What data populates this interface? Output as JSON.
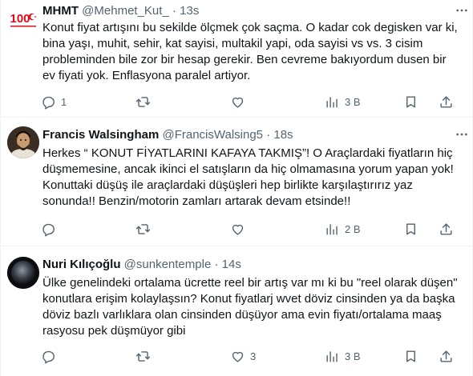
{
  "tweets": [
    {
      "name": "MHMT",
      "handle": "@Mehmet_Kut_",
      "dot": "·",
      "time": "13s",
      "avatar_badge": "100",
      "text": "Konut fiyat artışını bu sekilde ölçmek çok saçma. O kadar cok degisken var ki, bina yaşı, muhit, sehir, kat sayisi, multakil yapi, oda sayisi vs vs. 3 cisim probleminden bile zor bir hesap gerekir. Ben cevreme bakıyordum dusen bir ev fiyati yok. Enflasyona paralel artiyor.",
      "replies": "1",
      "retweets": "",
      "likes": "",
      "views": "3 B"
    },
    {
      "name": "Francis Walsingham",
      "handle": "@FrancisWalsing5",
      "dot": "·",
      "time": "18s",
      "text": "Herkes “ KONUT FİYATLARINI KAFAYA TAKMIŞ”!  O Araçlardaki fiyatların hiç düşmemesine, ancak ikinci el satışların da hiç olmamasına yorum yapan yok! Konuttaki düşüş ile araçlardaki düşüşleri hep birlikte karşılaştırırız yaz sonunda!! Benzin/motorin zamları artarak devam etsinde!!",
      "replies": "",
      "retweets": "",
      "likes": "",
      "views": "2 B"
    },
    {
      "name": "Nuri Kılıçoğlu",
      "handle": "@sunkentemple",
      "dot": "·",
      "time": "14s",
      "text": "Ülke genelindeki ortalama ücrette reel bir artış var mı ki bu \"reel olarak düşen\" konutlara erişim kolaylaşsın? Konut fiyatlarj wvet döviz cinsinden ya da başka döviz bazlı varlıklara olan cinsinden  düşüyor ama evin fiyatı/ortalama maaş rasyosu pek düşmüyor gibi",
      "replies": "",
      "retweets": "",
      "likes": "3",
      "views": "3 B"
    }
  ],
  "colors": {
    "text": "#0f1419",
    "secondary": "#536471",
    "border": "#eff3f4",
    "badge_red": "#e30a17"
  },
  "icons": [
    "reply-icon",
    "retweet-icon",
    "like-icon",
    "views-icon",
    "share-icon",
    "more-icon"
  ]
}
